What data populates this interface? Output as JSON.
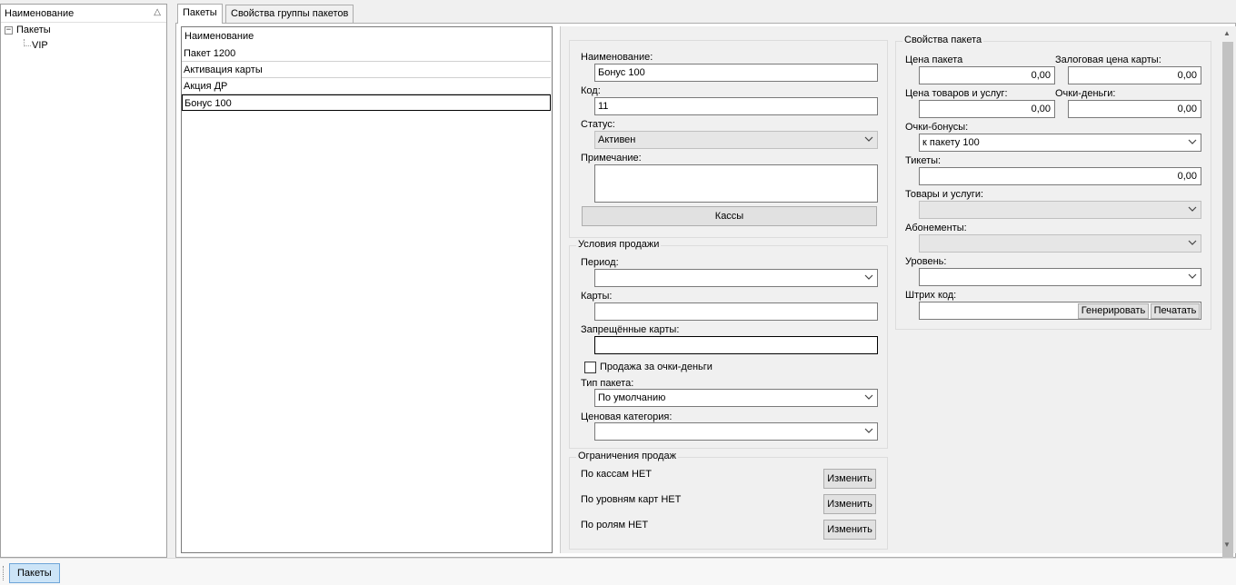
{
  "tree": {
    "header": "Наименование",
    "sort_glyph": "△",
    "root_label": "Пакеты",
    "root_expander": "⊟",
    "child_label": "VIP"
  },
  "tabs": [
    {
      "label": "Пакеты",
      "active": true
    },
    {
      "label": "Свойства группы пакетов",
      "active": false
    }
  ],
  "list": {
    "header": "Наименование",
    "rows": [
      "Пакет 1200",
      "Активация карты",
      "Акция ДР",
      "Бонус 100"
    ],
    "selected_index": 3
  },
  "main_group": {
    "name_label": "Наименование:",
    "name_value": "Бонус 100",
    "code_label": "Код:",
    "code_value": "11",
    "status_label": "Статус:",
    "status_value": "Активен",
    "note_label": "Примечание:",
    "note_value": "",
    "cash_button": "Кассы"
  },
  "sale_conditions": {
    "title": "Условия продажи",
    "period_label": "Период:",
    "period_value": "",
    "cards_label": "Карты:",
    "cards_value": "",
    "forbidden_label": "Запрещённые карты:",
    "forbidden_value": "",
    "points_money_checkbox": "Продажа за очки-деньги",
    "points_money_checked": false,
    "type_label": "Тип пакета:",
    "type_value": "По умолчанию",
    "price_cat_label": "Ценовая категория:",
    "price_cat_value": ""
  },
  "restrictions": {
    "title": "Ограничения продаж",
    "items": [
      {
        "text": "По кассам НЕТ",
        "button": "Изменить"
      },
      {
        "text": "По уровням карт НЕТ",
        "button": "Изменить"
      },
      {
        "text": "По ролям НЕТ",
        "button": "Изменить"
      }
    ]
  },
  "properties": {
    "title": "Свойства пакета",
    "price_label": "Цена пакета",
    "price_value": "0,00",
    "deposit_label": "Залоговая цена карты:",
    "deposit_value": "0,00",
    "goods_price_label": "Цена товаров и услуг:",
    "goods_price_value": "0,00",
    "points_money_label": "Очки-деньги:",
    "points_money_value": "0,00",
    "bonus_label": "Очки-бонусы:",
    "bonus_value": "к пакету 100",
    "tickets_label": "Тикеты:",
    "tickets_value": "0,00",
    "goods_label": "Товары и услуги:",
    "goods_value": "",
    "subs_label": "Абонементы:",
    "subs_value": "",
    "level_label": "Уровень:",
    "level_value": "",
    "barcode_label": "Штрих код:",
    "barcode_value": "",
    "generate_button": "Генерировать",
    "print_button": "Печатать"
  },
  "bottom": {
    "tab_label": "Пакеты"
  },
  "colors": {
    "window_bg": "#f0f0f0",
    "selected_tab_bg": "#cce4f7"
  }
}
